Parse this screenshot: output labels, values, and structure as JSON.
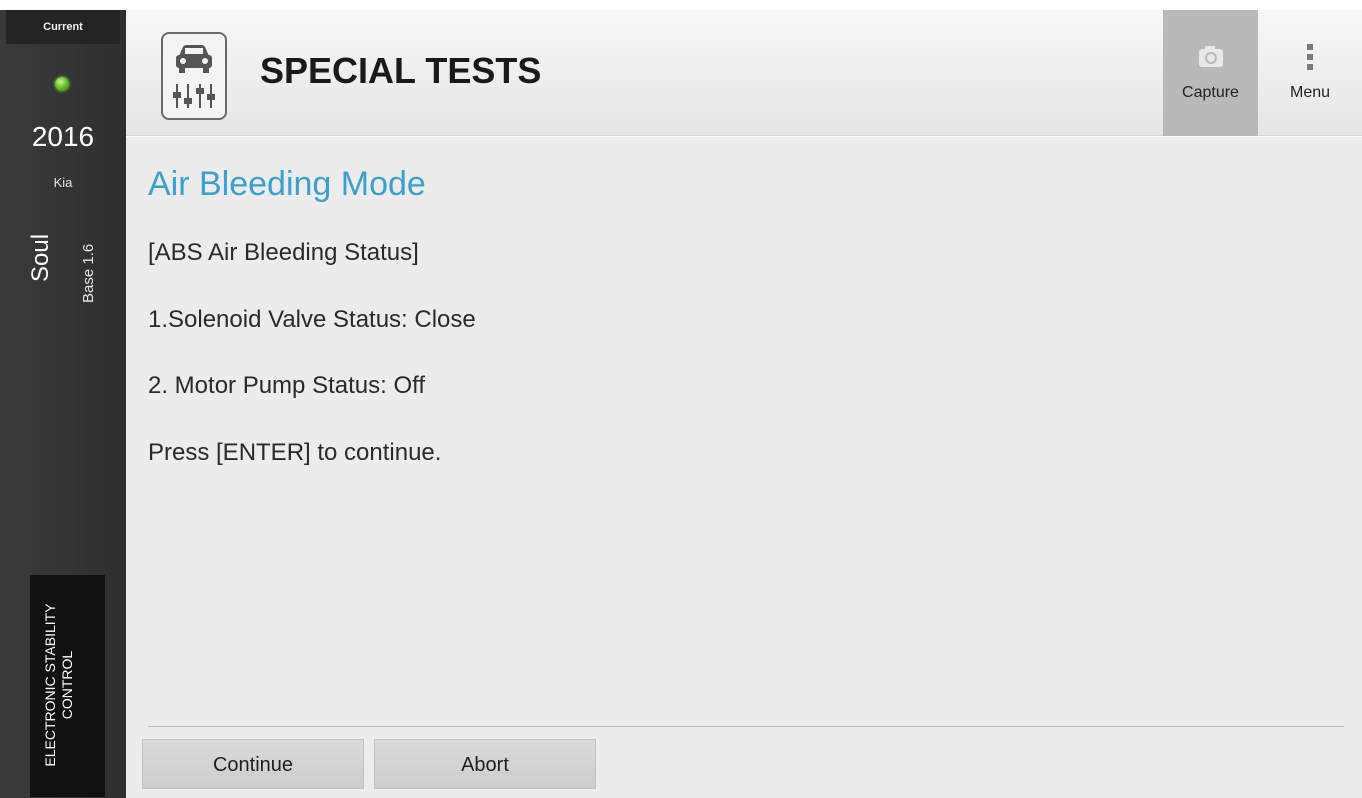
{
  "sidebar": {
    "current_label": "Current",
    "status_color": "#6cc22c",
    "year": "2016",
    "make": "Kia",
    "model": "Soul",
    "trim": "Base 1.6",
    "system": "ELECTRONIC STABILITY CONTROL"
  },
  "header": {
    "title": "SPECIAL TESTS",
    "app_icon": "car-test-icon",
    "capture_label": "Capture",
    "capture_icon": "camera-icon",
    "menu_label": "Menu",
    "menu_icon": "kebab-menu-icon"
  },
  "main": {
    "heading": "Air Bleeding Mode",
    "heading_color": "#3b9fcf",
    "lines": [
      "[ABS Air Bleeding Status]",
      "1.Solenoid Valve Status: Close",
      "2. Motor Pump Status: Off",
      "Press [ENTER] to continue."
    ]
  },
  "actions": {
    "continue_label": "Continue",
    "abort_label": "Abort"
  }
}
